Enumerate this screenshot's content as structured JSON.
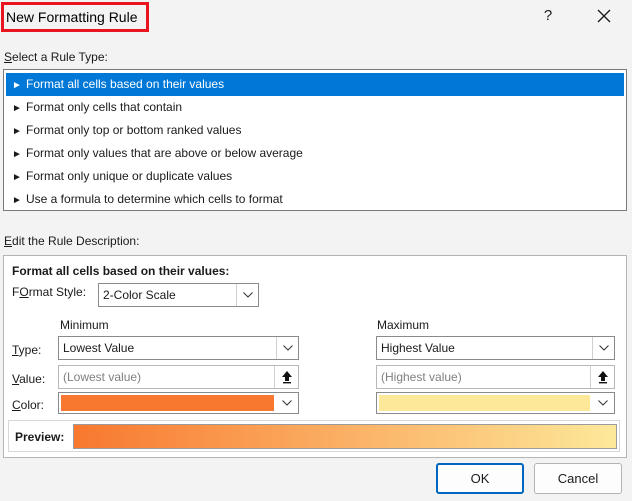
{
  "dialog": {
    "title": "New Formatting Rule",
    "help_glyph": "?",
    "close_icon": "close-icon"
  },
  "rule_type": {
    "label_accel": "S",
    "label_rest": "elect a Rule Type:",
    "items": [
      {
        "label": "Format all cells based on their values",
        "selected": true
      },
      {
        "label": "Format only cells that contain",
        "selected": false
      },
      {
        "label": "Format only top or bottom ranked values",
        "selected": false
      },
      {
        "label": "Format only values that are above or below average",
        "selected": false
      },
      {
        "label": "Format only unique or duplicate values",
        "selected": false
      },
      {
        "label": "Use a formula to determine which cells to format",
        "selected": false
      }
    ],
    "arrow_glyph": "►"
  },
  "description": {
    "label_accel": "E",
    "label_rest": "dit the Rule Description:",
    "heading": "Format all cells based on their values:",
    "format_style_accel": "O",
    "format_style_pre": "F",
    "format_style_rest": "rmat Style:",
    "format_style_value": "2-Color Scale",
    "minimum_heading": "Minimum",
    "maximum_heading": "Maximum",
    "type_label_accel": "T",
    "type_label_rest": "ype:",
    "value_label_accel": "V",
    "value_label_rest": "alue:",
    "color_label_accel": "C",
    "color_label_rest": "olor:",
    "min_type": "Lowest Value",
    "max_type": "Highest Value",
    "min_value_placeholder": "(Lowest value)",
    "max_value_placeholder": "(Highest value)",
    "min_color": "#f8782f",
    "max_color": "#fde89a",
    "preview_label": "Preview:"
  },
  "buttons": {
    "ok": "OK",
    "cancel": "Cancel"
  },
  "colors": {
    "selection": "#0078d7",
    "title_highlight": "#e8141f"
  }
}
